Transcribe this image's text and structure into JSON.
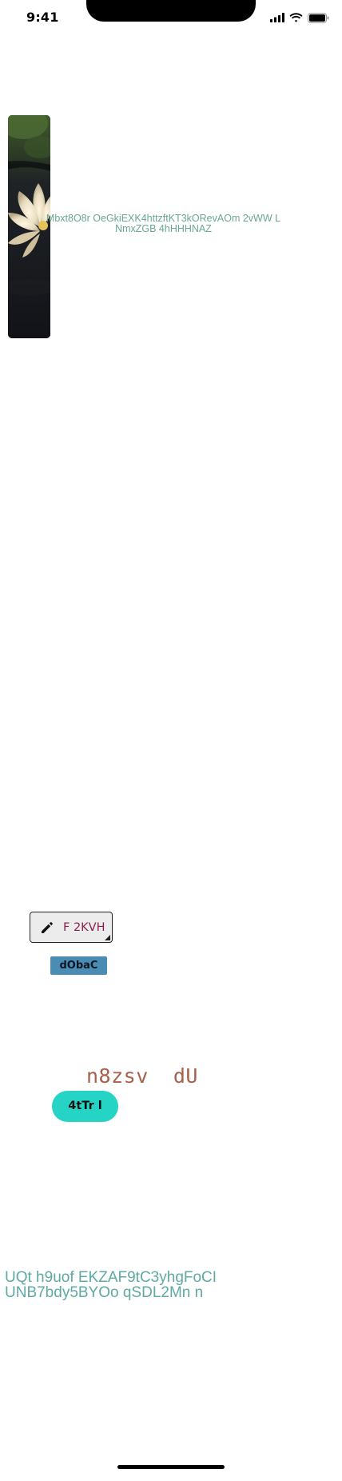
{
  "status_bar": {
    "time": "9:41"
  },
  "image_card": {
    "overlay_text": "Mbxt8O8r OeGkiEXK4httzftKT3kORevAOm 2vWW L NmxZGB 4hHHHNAZ"
  },
  "edit_button": {
    "label": "F 2KVH",
    "icon": "pencil-icon"
  },
  "small_button": {
    "label": "dObaC",
    "color": "#4a8db4"
  },
  "mono_text": "n8zsv  dU",
  "pill_button": {
    "label": "4tTr l",
    "color": "#25d4c4"
  },
  "bottom_text": "UQt h9uof EKZAF9tC3yhgFoCI UNB7bdy5BYOo qSDL2Mn n",
  "colors": {
    "overlay_text": "#6aa78f",
    "edit_label": "#8b1f52",
    "mono_text": "#a7604b",
    "bottom_text": "#5fa9a3"
  }
}
